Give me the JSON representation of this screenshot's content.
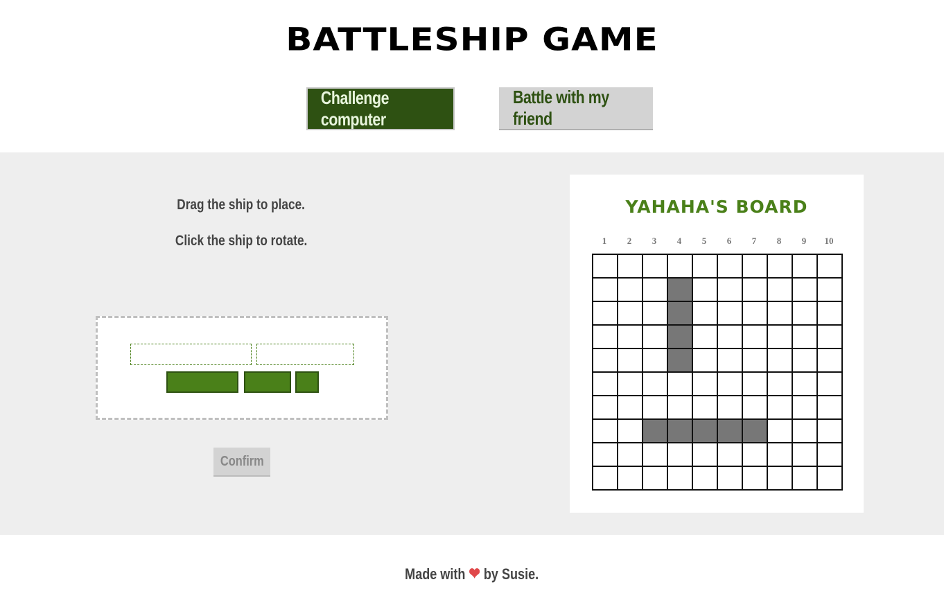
{
  "header": {
    "title": "BATTLESHIP GAME"
  },
  "modes": {
    "computer_label": "Challenge computer",
    "friend_label": "Battle with my friend"
  },
  "instructions": {
    "drag": "Drag the ship to place.",
    "rotate": "Click the ship to rotate."
  },
  "confirm_label": "Confirm",
  "board": {
    "title": "YAHAHA'S BOARD",
    "columns": [
      "1",
      "2",
      "3",
      "4",
      "5",
      "6",
      "7",
      "8",
      "9",
      "10"
    ],
    "rows": 10,
    "ship_cells": [
      [
        1,
        3
      ],
      [
        2,
        3
      ],
      [
        3,
        3
      ],
      [
        4,
        3
      ],
      [
        7,
        2
      ],
      [
        7,
        3
      ],
      [
        7,
        4
      ],
      [
        7,
        5
      ],
      [
        7,
        6
      ]
    ]
  },
  "footer": {
    "prefix": "Made with",
    "heart": "❤",
    "suffix": "by Susie."
  },
  "colors": {
    "accent_dark": "#2e5112",
    "accent": "#4a8019",
    "ship_placed": "#777777",
    "panel_bg": "#eeeeee"
  }
}
